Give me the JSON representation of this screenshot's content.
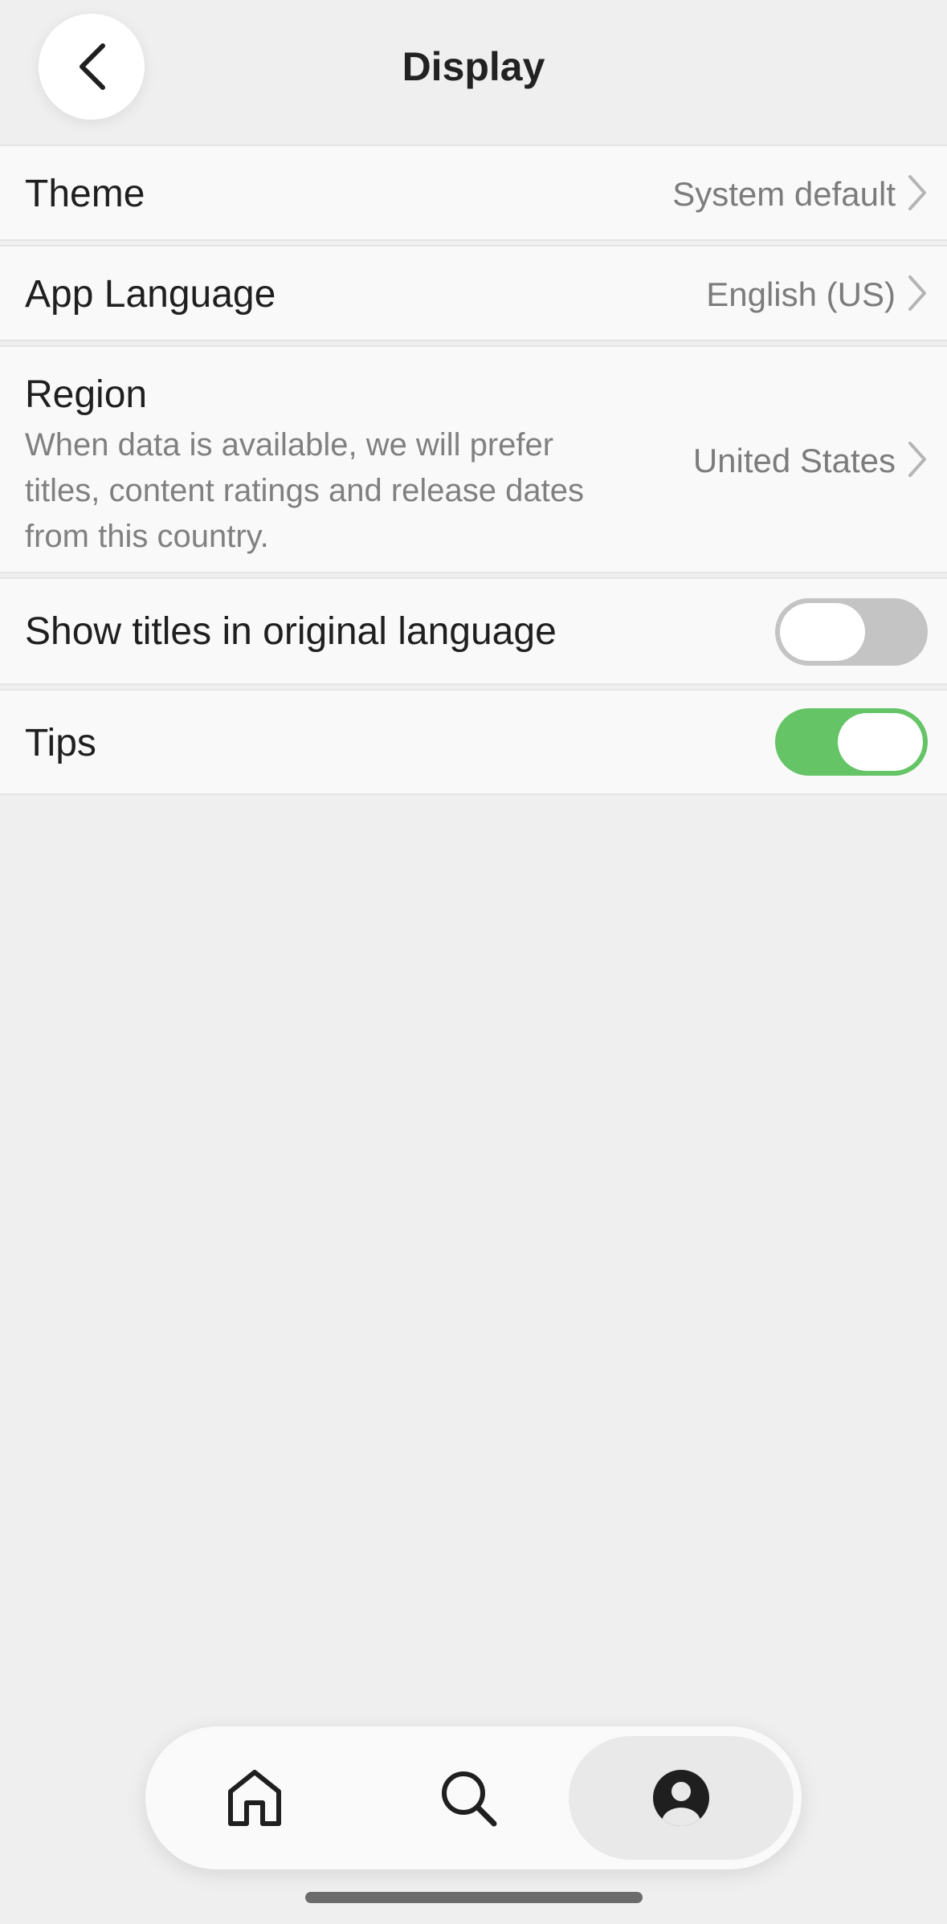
{
  "header": {
    "title": "Display",
    "back_icon": "chevron-left-icon"
  },
  "settings": {
    "theme": {
      "label": "Theme",
      "value": "System default"
    },
    "language": {
      "label": "App Language",
      "value": "English (US)"
    },
    "region": {
      "label": "Region",
      "description": "When data is available, we will prefer titles, content ratings and release dates from this country.",
      "value": "United States"
    },
    "original_titles": {
      "label": "Show titles in original language",
      "enabled": false
    },
    "tips": {
      "label": "Tips",
      "enabled": true
    }
  },
  "tabbar": {
    "tabs": [
      {
        "icon": "home-icon",
        "active": false
      },
      {
        "icon": "search-icon",
        "active": false
      },
      {
        "icon": "profile-icon",
        "active": true
      }
    ]
  },
  "colors": {
    "toggle_on": "#65c466",
    "toggle_off": "#c4c4c4",
    "background": "#efefef"
  }
}
